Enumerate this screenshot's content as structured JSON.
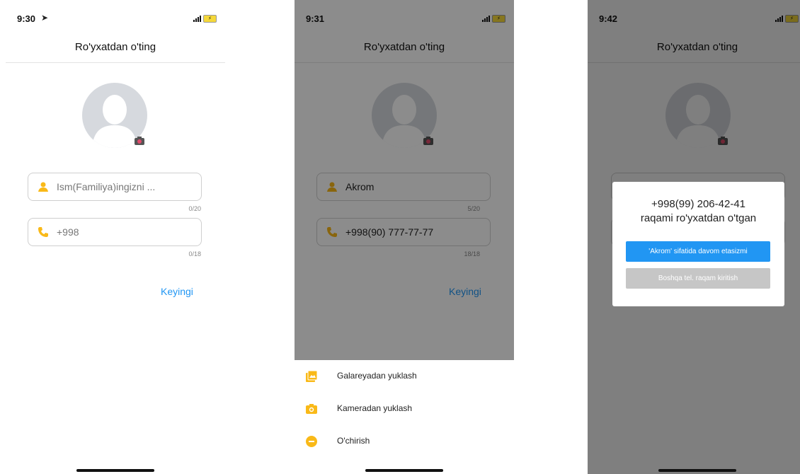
{
  "screens": [
    {
      "time": "9:30",
      "header_title": "Ro'yxatdan o'ting",
      "name_field": {
        "value": "",
        "placeholder": "Ism(Familiya)ingizni ...",
        "counter": "0/20"
      },
      "phone_field": {
        "value": "",
        "placeholder": "+998",
        "counter": "0/18"
      },
      "next_label": "Keyingi"
    },
    {
      "time": "9:31",
      "header_title": "Ro'yxatdan o'ting",
      "name_field": {
        "value": "Akrom",
        "counter": "5/20"
      },
      "phone_field": {
        "value": "+998(90) 777-77-77",
        "counter": "18/18"
      },
      "next_label": "Keyingi",
      "sheet": {
        "items": [
          {
            "label": "Galareyadan yuklash",
            "icon": "gallery-icon"
          },
          {
            "label": "Kameradan yuklash",
            "icon": "camera-icon"
          },
          {
            "label": "O'chirish",
            "icon": "remove-icon"
          }
        ]
      }
    },
    {
      "time": "9:42",
      "header_title": "Ro'yxatdan o'ting",
      "dialog": {
        "line1": "+998(99) 206-42-41",
        "line2": "raqami ro'yxatdan o'tgan",
        "primary_button": "'Akrom' sifatida davom etasizmi",
        "secondary_button": "Boshqa tel. raqam kiritish"
      }
    }
  ],
  "colors": {
    "accent": "#2196f3",
    "icon_yellow": "#f9b918",
    "disabled": "#c6c6c6",
    "avatar": "#d6d9de"
  }
}
